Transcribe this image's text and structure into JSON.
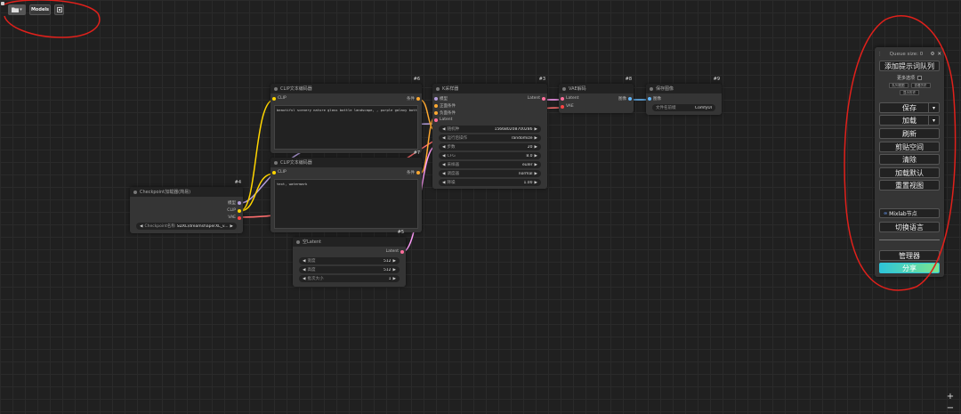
{
  "toolbar": {
    "folder_icon": "folder-icon",
    "folder_caret": "▾",
    "models_label": "Models",
    "image_icon": "image-icon"
  },
  "nodes": {
    "clip_pos": {
      "id": "#6",
      "title": "CLIP文本编码器",
      "input_clip": "CLIP",
      "output": "条件",
      "text": "beautiful scenery nature glass bottle landscape, , purple galaxy bottle,"
    },
    "clip_neg": {
      "id": "#7",
      "title": "CLIP文本编码器",
      "input_clip": "CLIP",
      "output": "条件",
      "text": "text, watermark"
    },
    "ksampler": {
      "id": "#3",
      "title": "K采样器",
      "inputs": [
        "模型",
        "正面条件",
        "负面条件",
        "Latent"
      ],
      "output": "Latent",
      "widgets": [
        {
          "label": "随机种",
          "value": "156680208700286"
        },
        {
          "label": "运行后操作",
          "value": "randomize"
        },
        {
          "label": "步数",
          "value": "20"
        },
        {
          "label": "CFG",
          "value": "8.0"
        },
        {
          "label": "采样器",
          "value": "euler"
        },
        {
          "label": "调度器",
          "value": "normal"
        },
        {
          "label": "降噪",
          "value": "1.00"
        }
      ]
    },
    "vae_decode": {
      "id": "#8",
      "title": "VAE解码",
      "inputs": [
        "Latent",
        "VAE"
      ],
      "output": "图像"
    },
    "save_image": {
      "id": "#9",
      "title": "保存图像",
      "input": "图像",
      "widget_label": "文件名前缀",
      "widget_value": "ComfyUI"
    },
    "checkpoint": {
      "id": "#4",
      "title": "Checkpoint加载器(简易)",
      "outputs": [
        "模型",
        "CLIP",
        "VAE"
      ],
      "widget_label": "Checkpoint名称",
      "widget_value": "SDXL\\dreamshaperXL_v..."
    },
    "empty_latent": {
      "id": "#5",
      "title": "空Latent",
      "output": "Latent",
      "widgets": [
        {
          "label": "宽度",
          "value": "512"
        },
        {
          "label": "高度",
          "value": "512"
        },
        {
          "label": "批次大小",
          "value": "1"
        }
      ]
    }
  },
  "menu": {
    "queue_size": "Queue size: 0",
    "add_queue": "添加提示词队列",
    "extra_options": "更多选项",
    "mini_buttons": [
      "队列视图",
      "查看历史",
      "显示历史"
    ],
    "save": "保存",
    "load": "加载",
    "refresh": "刷新",
    "clipspace": "剪贴空间",
    "clear": "清除",
    "load_default": "加载默认",
    "reset_view": "重置视图",
    "mixlab_icon": "mixlab-icon",
    "mixlab": "Mixlab节点",
    "switch_lang": "切换语言",
    "manager": "管理器",
    "share": "分享",
    "caret": "▾"
  },
  "zoom": {
    "plus": "+",
    "minus": "−"
  },
  "colors": {
    "clip_wire": "#ffd500",
    "cond_wire": "#ffa931",
    "latent_wire": "#ff9cf9",
    "vae_wire": "#ff6e6e",
    "image_wire": "#64b5f6",
    "annotation": "#e0201b",
    "share_gradient_start": "#2ec4d8",
    "share_gradient_end": "#7be58e"
  }
}
